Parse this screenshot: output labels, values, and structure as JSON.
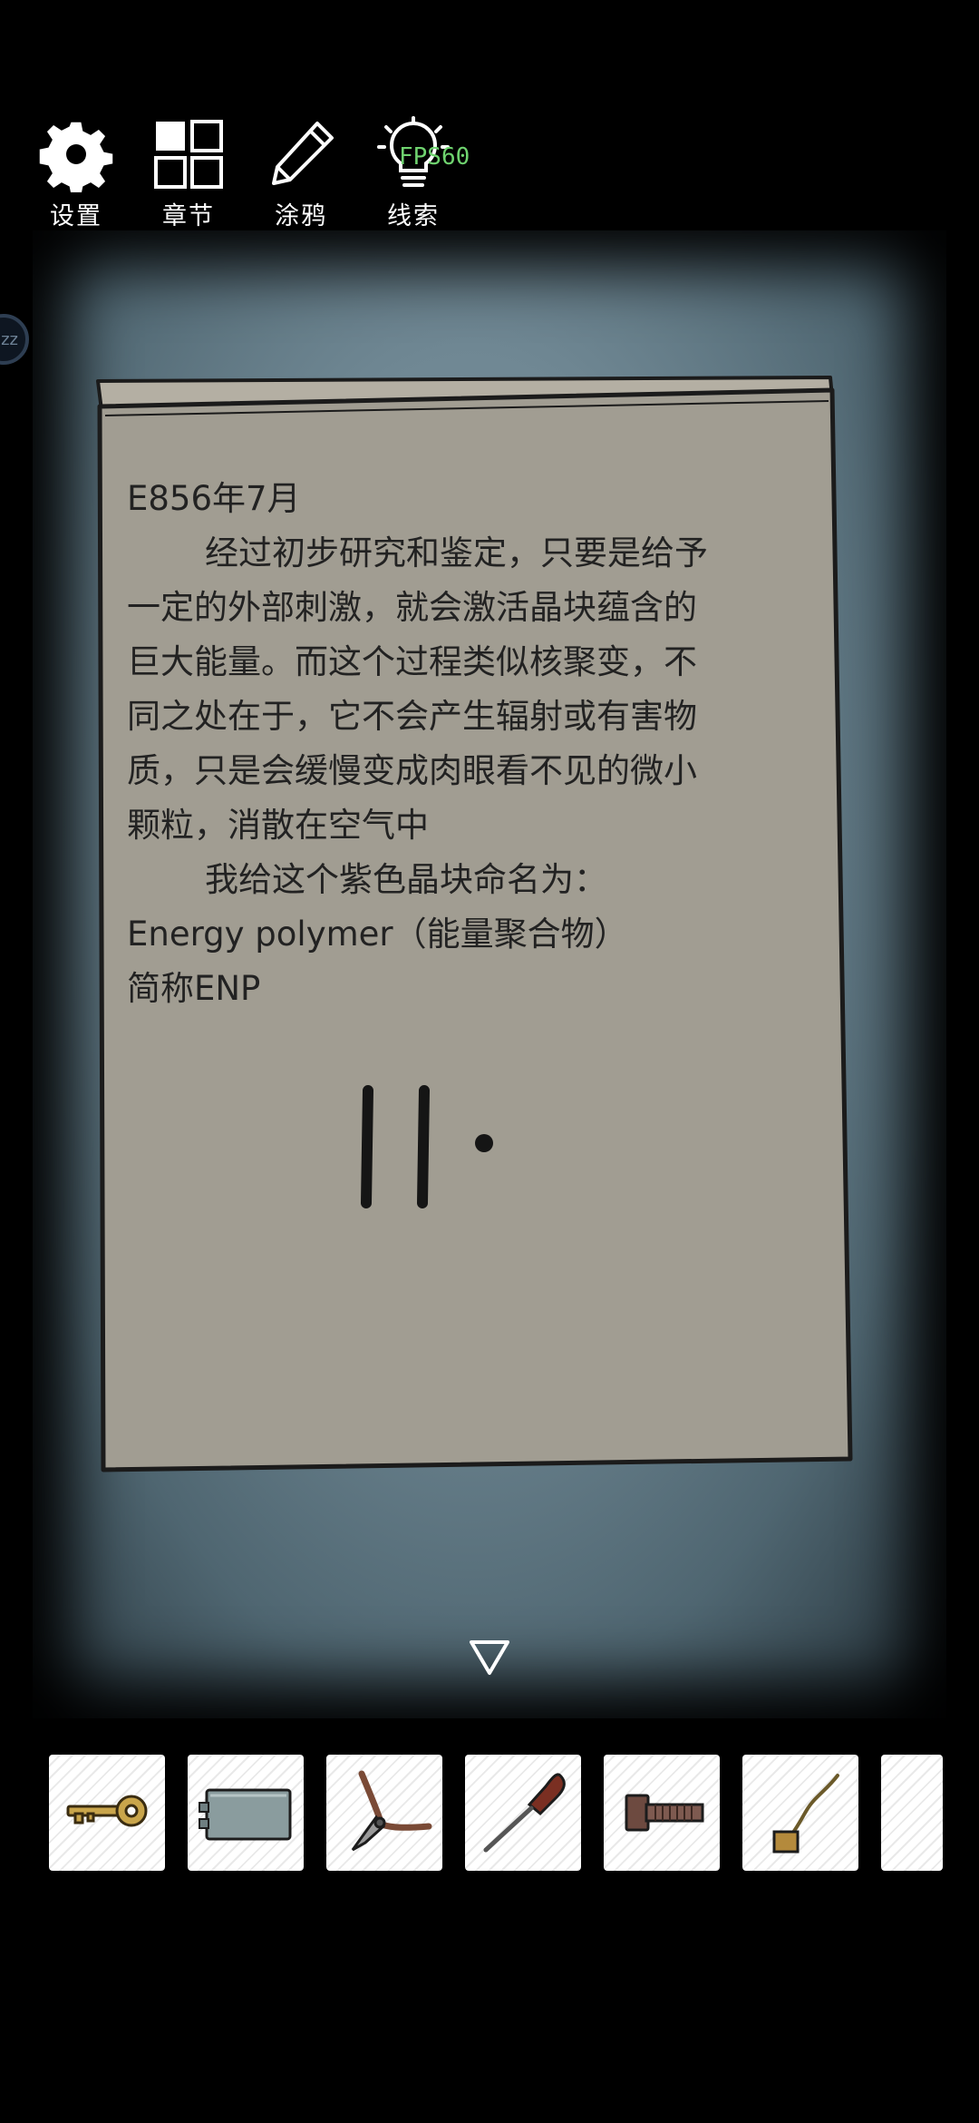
{
  "toolbar": {
    "settings_label": "设置",
    "chapters_label": "章节",
    "doodle_label": "涂鸦",
    "hints_label": "线索"
  },
  "overlay": {
    "fps_text": "FPS60",
    "side_bubble_text": "zz"
  },
  "note": {
    "lines": [
      "E856年7月",
      "经过初步研究和鉴定，只要是给予",
      "一定的外部刺激，就会激活晶块蕴含的",
      "巨大能量。而这个过程类似核聚变，不",
      "同之处在于，它不会产生辐射或有害物",
      "质，只是会缓慢变成肉眼看不见的微小",
      "颗粒，消散在空气中",
      "我给这个紫色晶块命名为：",
      "Energy polymer（能量聚合物）",
      "简称ENP"
    ]
  },
  "inventory": {
    "items": [
      {
        "icon": "key-icon"
      },
      {
        "icon": "battery-icon"
      },
      {
        "icon": "pliers-icon"
      },
      {
        "icon": "screwdriver-icon"
      },
      {
        "icon": "bolt-icon"
      },
      {
        "icon": "wire-icon"
      },
      {
        "icon": "empty-slot"
      }
    ]
  },
  "colors": {
    "paper": "#a19d92",
    "background": "#000000",
    "scene": "#6f8793",
    "fps": "#6fd36f"
  }
}
